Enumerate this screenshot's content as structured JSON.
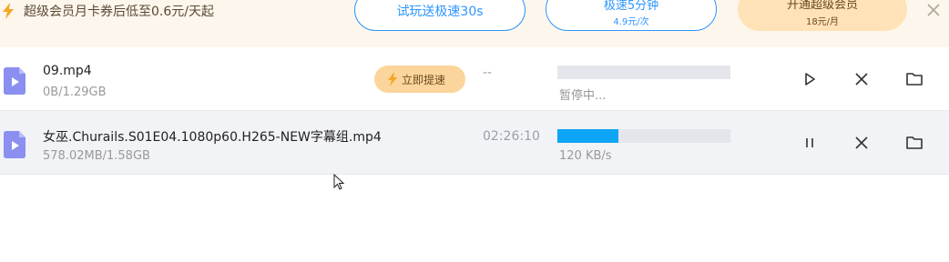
{
  "banner": {
    "promo_text": "超级会员月卡券后低至0.6元/天起",
    "trial_button": "试玩送极速30s",
    "speed_button": {
      "main": "极速5分钟",
      "sub": "4.9元/次"
    },
    "vip_button": {
      "main": "开通超级会员",
      "sub": "18元/月"
    },
    "icons": {
      "promo": "lightning-icon",
      "close": "close-icon"
    }
  },
  "downloads": [
    {
      "name": "09.mp4",
      "size": "0B/1.29GB",
      "boost_label": "立即提速",
      "eta": "--",
      "progress": 0.0,
      "status": "暂停中...",
      "actions": [
        "play-icon",
        "close-icon",
        "folder-icon"
      ]
    },
    {
      "name": "女巫.Churails.S01E04.1080p60.H265-NEW字幕组.mp4",
      "size": "578.02MB/1.58GB",
      "eta": "02:26:10",
      "progress": 0.35,
      "status": "120 KB/s",
      "actions": [
        "pause-icon",
        "close-icon",
        "folder-icon"
      ]
    }
  ],
  "colors": {
    "banner_bg": "#fdf6ec",
    "accent_blue": "#2d95ff",
    "progress_blue": "#0ea5f6",
    "file_icon": "#8a8ff0",
    "vip_gold": "#ffe2b8",
    "boost_orange": "#fbd59b"
  }
}
